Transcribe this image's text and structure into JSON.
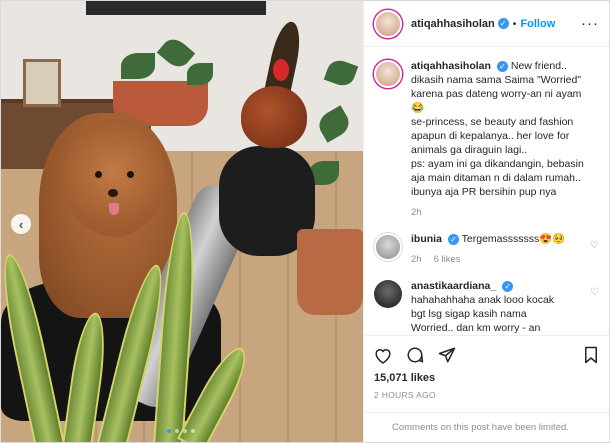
{
  "header": {
    "username": "atiqahhasiholan",
    "follow_label": "Follow",
    "separator": "•",
    "more_icon": "more-horizontal-icon"
  },
  "caption": {
    "username": "atiqahhasiholan",
    "lines": [
      "New friend..",
      "dikasih nama sama Saima \"Worried\"",
      "karena pas dateng worry-an ni ayam",
      "😂",
      "se-princess, se beauty and fashion",
      "apapun di kepalanya.. her love for",
      "animals ga diraguin lagi..",
      "ps: ayam ini ga dikandangin, bebasin",
      "aja main ditaman n di dalam rumah..",
      "ibunya aja PR bersihin pup nya"
    ],
    "time": "2h"
  },
  "comments": [
    {
      "username": "ibunia",
      "verified": true,
      "text": "Tergemasssssss😍🥺",
      "time": "2h",
      "likes": "6 likes"
    },
    {
      "username": "anastikaardiana_",
      "verified": true,
      "lines": [
        "hahahahhaha anak looo kocak",
        "bgt lsg sigap kasih nama",
        "Worried.. dan km worry - an"
      ]
    }
  ],
  "actions": {
    "likes": "15,071 likes",
    "timestamp": "2 HOURS AGO",
    "icons": [
      "heart-icon",
      "comment-icon",
      "share-icon",
      "bookmark-icon"
    ]
  },
  "footer": {
    "notice": "Comments on this post have been limited."
  },
  "media": {
    "carousel_dots": 4,
    "active_dot": 0,
    "nav": "‹"
  },
  "colors": {
    "accent": "#0095f6",
    "verified": "#3897f0",
    "muted": "#8e8e8e"
  }
}
